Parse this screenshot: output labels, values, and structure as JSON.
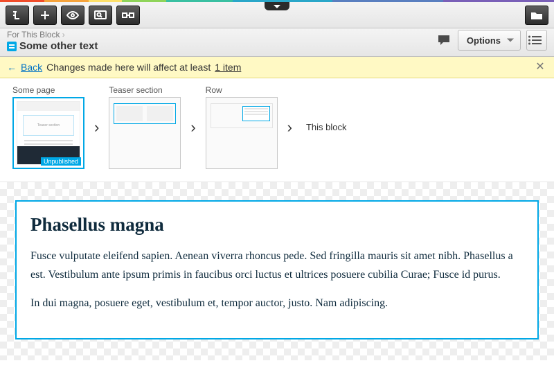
{
  "breadcrumb": {
    "context": "For This Block",
    "title": "Some other text"
  },
  "header": {
    "options_label": "Options"
  },
  "warning": {
    "back_label": "Back",
    "message": "Changes made here will affect at least",
    "item_link": "1 item"
  },
  "trail": {
    "items": [
      {
        "label": "Some page",
        "badge": "Unpublished"
      },
      {
        "label": "Teaser section"
      },
      {
        "label": "Row"
      }
    ],
    "current": "This block"
  },
  "content": {
    "heading": "Phasellus magna",
    "p1": "Fusce vulputate eleifend sapien. Aenean viverra rhoncus pede. Sed fringilla mauris sit amet nibh. Phasellus a est. Vestibulum ante ipsum primis in faucibus orci luctus et ultrices posuere cubilia Curae; Fusce id purus.",
    "p2": "In dui magna, posuere eget, vestibulum et, tempor auctor, justo. Nam adipiscing."
  },
  "thumb1_inner": "Teaser section"
}
